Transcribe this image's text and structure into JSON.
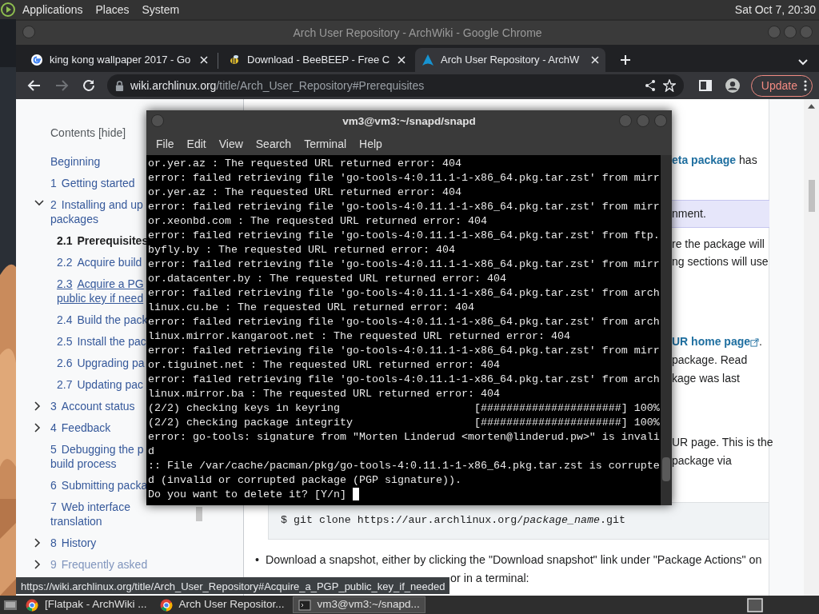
{
  "top_panel": {
    "menus": [
      "Applications",
      "Places",
      "System"
    ],
    "clock": "Sat Oct 7, 20:30"
  },
  "browser": {
    "title": "Arch User Repository - ArchWiki - Google Chrome",
    "tabs": [
      {
        "label": "king kong wallpaper 2017 - Go",
        "selected": false,
        "kind": "google"
      },
      {
        "label": "Download - BeeBEEP - Free C",
        "selected": false,
        "kind": "bee"
      },
      {
        "label": "Arch User Repository - ArchW",
        "selected": true,
        "kind": "arch"
      }
    ],
    "forward_enabled": false,
    "url": {
      "host": "wiki.archlinux.org",
      "path": "/title/Arch_User_Repository#Prerequisites"
    },
    "update_button": "Update"
  },
  "toc": {
    "title": "Contents",
    "toggle": "[hide]",
    "items": [
      {
        "lines": [
          "Beginning"
        ],
        "kind": "plain",
        "selected": false,
        "hovered": false,
        "faded": false
      },
      {
        "number": "1",
        "lines": [
          "Getting started"
        ],
        "kind": "plain",
        "selected": false,
        "hovered": false,
        "faded": false
      },
      {
        "number": "2",
        "lines": [
          "Installing and up",
          "packages"
        ],
        "kind": "open",
        "selected": false,
        "hovered": false,
        "faded": false,
        "children": [
          {
            "number": "2.1",
            "lines": [
              "Prerequisites"
            ],
            "selected": true,
            "hovered": false
          },
          {
            "number": "2.2",
            "lines": [
              "Acquire build"
            ],
            "selected": false,
            "hovered": false
          },
          {
            "number": "2.3",
            "lines": [
              "Acquire a PG",
              "public key if need"
            ],
            "selected": false,
            "hovered": true
          },
          {
            "number": "2.4",
            "lines": [
              "Build the pack"
            ],
            "selected": false,
            "hovered": false
          },
          {
            "number": "2.5",
            "lines": [
              "Install the pac"
            ],
            "selected": false,
            "hovered": false
          },
          {
            "number": "2.6",
            "lines": [
              "Upgrading pa"
            ],
            "selected": false,
            "hovered": false
          },
          {
            "number": "2.7",
            "lines": [
              "Updating pac"
            ],
            "selected": false,
            "hovered": false
          }
        ]
      },
      {
        "number": "3",
        "lines": [
          "Account status"
        ],
        "kind": "closed",
        "selected": false,
        "hovered": false,
        "faded": false
      },
      {
        "number": "4",
        "lines": [
          "Feedback"
        ],
        "kind": "closed",
        "selected": false,
        "hovered": false,
        "faded": false
      },
      {
        "number": "5",
        "lines": [
          "Debugging the p",
          "build process"
        ],
        "kind": "plain",
        "selected": false,
        "hovered": false,
        "faded": false
      },
      {
        "number": "6",
        "lines": [
          "Submitting packa"
        ],
        "kind": "plain",
        "selected": false,
        "hovered": false,
        "faded": false
      },
      {
        "number": "7",
        "lines": [
          "Web interface",
          "translation"
        ],
        "kind": "plain",
        "selected": false,
        "hovered": false,
        "faded": false
      },
      {
        "number": "8",
        "lines": [
          "History"
        ],
        "kind": "closed",
        "selected": false,
        "hovered": false,
        "faded": false
      },
      {
        "number": "9",
        "lines": [
          "Frequently asked"
        ],
        "kind": "closed",
        "selected": false,
        "hovered": false,
        "faded": true
      }
    ]
  },
  "article": {
    "fragments": [
      {
        "kind": "paragraph",
        "lines": [
          [
            {
              "text": "eta package",
              "link": true
            },
            {
              "text": " has",
              "link": false
            }
          ]
        ]
      },
      {
        "kind": "note",
        "lines": [
          [
            {
              "text": "nment.",
              "link": false
            }
          ]
        ]
      },
      {
        "kind": "paragraph",
        "lines": [
          [
            {
              "text": "re the package will",
              "link": false
            }
          ],
          [
            {
              "text": "ng sections will use",
              "link": false
            }
          ]
        ]
      },
      {
        "kind": "paragraph",
        "lines": [
          [
            {
              "text": "UR home page",
              "link": true,
              "external": true
            },
            {
              "text": ".",
              "link": false
            }
          ],
          [
            {
              "text": "package. Read",
              "link": false
            }
          ],
          [
            {
              "text": "kage was last",
              "link": false
            }
          ]
        ]
      },
      {
        "kind": "paragraph",
        "lines": [
          [
            {
              "text": "UR page. This is the",
              "link": false
            }
          ],
          [
            {
              "text": "package via",
              "link": false
            }
          ]
        ]
      }
    ],
    "code": "$ git clone https://aur.archlinux.org/*package_name*.git",
    "bullet": {
      "marker": "•",
      "lines": [
        "Download a snapshot, either by clicking the \"Download snapshot\" link under \"Package Actions\" on",
        "or in a terminal:"
      ]
    }
  },
  "terminal": {
    "title": "vm3@vm3:~/snapd/snapd",
    "menus": [
      "File",
      "Edit",
      "View",
      "Search",
      "Terminal",
      "Help"
    ],
    "lines": [
      "or.yer.az : The requested URL returned error: 404",
      "error: failed retrieving file 'go-tools-4:0.11.1-1-x86_64.pkg.tar.zst' from mirr",
      "or.yer.az : The requested URL returned error: 404",
      "error: failed retrieving file 'go-tools-4:0.11.1-1-x86_64.pkg.tar.zst' from mirr",
      "or.xeonbd.com : The requested URL returned error: 404",
      "error: failed retrieving file 'go-tools-4:0.11.1-1-x86_64.pkg.tar.zst' from ftp.",
      "byfly.by : The requested URL returned error: 404",
      "error: failed retrieving file 'go-tools-4:0.11.1-1-x86_64.pkg.tar.zst' from mirr",
      "or.datacenter.by : The requested URL returned error: 404",
      "error: failed retrieving file 'go-tools-4:0.11.1-1-x86_64.pkg.tar.zst' from arch",
      "linux.cu.be : The requested URL returned error: 404",
      "error: failed retrieving file 'go-tools-4:0.11.1-1-x86_64.pkg.tar.zst' from arch",
      "linux.mirror.kangaroot.net : The requested URL returned error: 404",
      "error: failed retrieving file 'go-tools-4:0.11.1-1-x86_64.pkg.tar.zst' from mirr",
      "or.tiguinet.net : The requested URL returned error: 404",
      "error: failed retrieving file 'go-tools-4:0.11.1-1-x86_64.pkg.tar.zst' from arch",
      "linux.mirror.ba : The requested URL returned error: 404",
      "(2/2) checking keys in keyring                     [######################] 100%",
      "(2/2) checking package integrity                   [######################] 100%",
      "error: go-tools: signature from \"Morten Linderud <morten@linderud.pw>\" is invali",
      "d",
      ":: File /var/cache/pacman/pkg/go-tools-4:0.11.1-1-x86_64.pkg.tar.zst is corrupte",
      "d (invalid or corrupted package (PGP signature)).",
      "Do you want to delete it? [Y/n] "
    ]
  },
  "status_url": "https://wiki.archlinux.org/title/Arch_User_Repository#Acquire_a_PGP_public_key_if_needed",
  "taskbar": {
    "tasks": [
      {
        "label": "[Flatpak - ArchWiki ...",
        "kind": "browser",
        "selected": false
      },
      {
        "label": "Arch User Repositor...",
        "kind": "browser",
        "selected": false
      },
      {
        "label": "vm3@vm3:~/snapd...",
        "kind": "terminal",
        "selected": true
      }
    ]
  }
}
